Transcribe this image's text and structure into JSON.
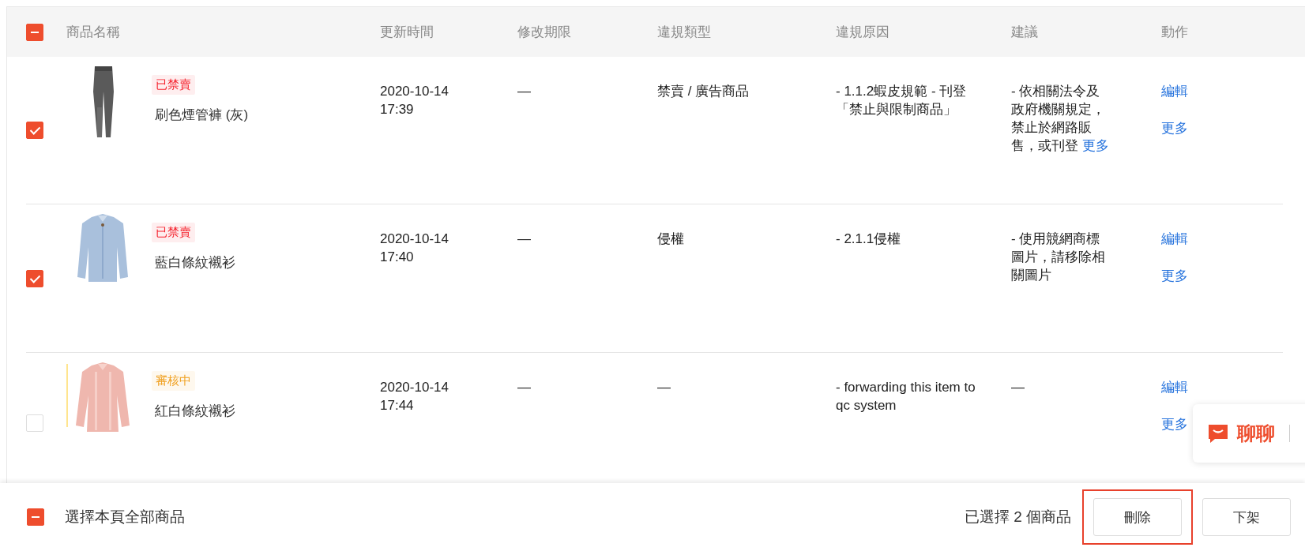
{
  "table": {
    "header_checkbox": {
      "indeterminate": true
    },
    "columns": [
      "商品名稱",
      "更新時間",
      "修改期限",
      "違規類型",
      "違規原因",
      "建議",
      "動作"
    ],
    "rows": [
      {
        "checked": true,
        "tag": {
          "label": "已禁賣",
          "color": "#f5222d"
        },
        "name": "刷色煙管褲 (灰)",
        "updated": [
          "2020-10-14",
          "17:39"
        ],
        "deadline": "—",
        "violation_type": "禁賣 / 廣告商品",
        "reason": "- 1.1.2蝦皮規範 - 刊登「禁止與限制商品」",
        "suggestion": "- 依相關法令及政府機關規定，禁止於網路販售，或刊登",
        "suggestion_more": "更多",
        "actions": [
          "編輯",
          "更多"
        ]
      },
      {
        "checked": true,
        "tag": {
          "label": "已禁賣",
          "color": "#f5222d"
        },
        "name": "藍白條紋襯衫",
        "updated": [
          "2020-10-14",
          "17:40"
        ],
        "deadline": "—",
        "violation_type": "侵權",
        "reason": "- 2.1.1侵權",
        "suggestion": "- 使用競網商標圖片，請移除相關圖片",
        "actions": [
          "編輯",
          "更多"
        ]
      },
      {
        "checked": false,
        "tag": {
          "label": "審核中",
          "color": "#f0a020"
        },
        "name": "紅白條紋襯衫",
        "updated": [
          "2020-10-14",
          "17:44"
        ],
        "deadline": "—",
        "violation_type": "—",
        "reason": "- forwarding this item to qc system",
        "suggestion": "—",
        "actions": [
          "編輯",
          "更多"
        ]
      }
    ]
  },
  "footer": {
    "select_all": {
      "indeterminate": true,
      "label": "選擇本頁全部商品"
    },
    "selected_count": "已選擇 2 個商品",
    "buttons": [
      {
        "label": "刪除",
        "highlighted": true
      },
      {
        "label": "下架",
        "highlighted": false
      }
    ]
  },
  "chat": {
    "label": "聊聊"
  }
}
